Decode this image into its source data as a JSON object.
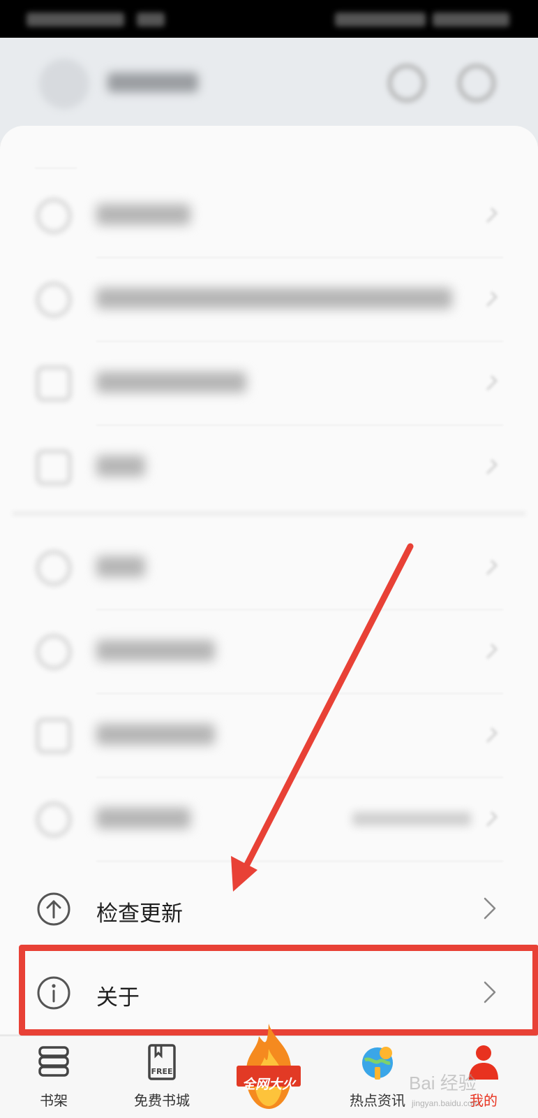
{
  "menu": {
    "check_update_label": "检查更新",
    "about_label": "关于"
  },
  "tabbar": {
    "tabs": [
      {
        "label": "书架"
      },
      {
        "label": "免费书城"
      },
      {
        "label": "全网大火"
      },
      {
        "label": "热点资讯"
      },
      {
        "label": "我的"
      }
    ],
    "free_badge": "FREE"
  },
  "watermark": {
    "text": "Bai 经验",
    "url": "jingyan.baidu.com"
  },
  "colors": {
    "accent_red": "#e8321f",
    "highlight_border": "#e84136",
    "arrow": "#e84136"
  }
}
